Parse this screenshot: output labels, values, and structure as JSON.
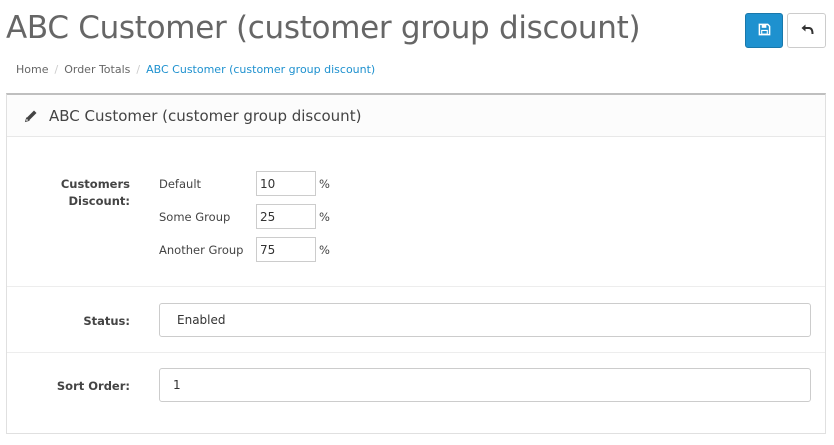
{
  "page": {
    "title": "ABC Customer (customer group discount)"
  },
  "toolbar": {
    "save_icon": "floppy-disk-icon",
    "back_icon": "reply-arrow-icon",
    "save_color": "#1e91cf"
  },
  "breadcrumb": {
    "items": [
      {
        "label": "Home"
      },
      {
        "label": "Order Totals"
      },
      {
        "label": "ABC Customer (customer group discount)"
      }
    ],
    "active_color": "#1e91cf"
  },
  "panel": {
    "icon": "pencil-icon",
    "heading": "ABC Customer (customer group discount)"
  },
  "form": {
    "discount": {
      "label_line1": "Customers",
      "label_line2": "Discount:",
      "unit": "%",
      "groups": [
        {
          "name": "Default",
          "value": "10"
        },
        {
          "name": "Some Group",
          "value": "25"
        },
        {
          "name": "Another Group",
          "value": "75"
        }
      ]
    },
    "status": {
      "label": "Status:",
      "value": "Enabled"
    },
    "sort_order": {
      "label": "Sort Order:",
      "value": "1"
    }
  }
}
